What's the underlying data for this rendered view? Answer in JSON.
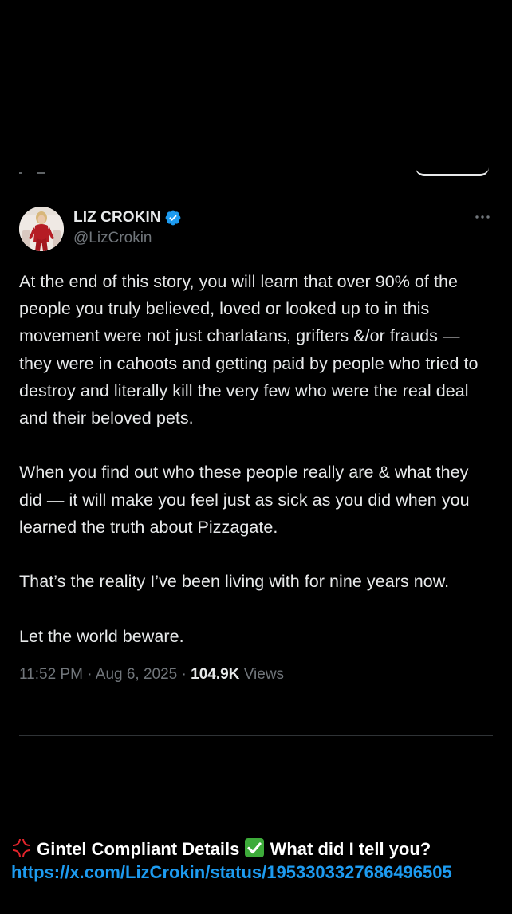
{
  "colors": {
    "background": "#000000",
    "text_primary": "#e7e9ea",
    "text_secondary": "#71767b",
    "verified_badge": "#1d9bf0",
    "link": "#1d9bf0",
    "divider": "#2f3336"
  },
  "tweet": {
    "author": {
      "display_name": "LIZ CROKIN",
      "handle": "@LizCrokin",
      "verified": true,
      "avatar_icon": "profile-photo"
    },
    "more_icon": "more-horizontal-icon",
    "body": "At the end of this story, you will learn that over 90% of the people you truly believed, loved or looked up to in this movement were not just charlatans, grifters &/or frauds — they were in cahoots and getting paid by people who tried to destroy and literally kill the very few who were the real deal and their beloved pets.\n\nWhen you find out who these people really are & what they did — it will make you feel just as sick as you did when you learned the truth about Pizzagate.\n\nThat’s the reality I’ve been living with for nine years now.\n\nLet the world beware.",
    "time": "11:52 PM",
    "date": "Aug 6, 2025",
    "separator": " · ",
    "views_count": "104.9K",
    "views_label": "Views"
  },
  "caption": {
    "prefix_icon": "anger-symbol-icon",
    "text1": " Gintel Compliant Details ",
    "check_icon": "check-mark-button-icon",
    "text2": " What did I tell you?",
    "link": "https://x.com/LizCrokin/status/1953303327686496505"
  }
}
